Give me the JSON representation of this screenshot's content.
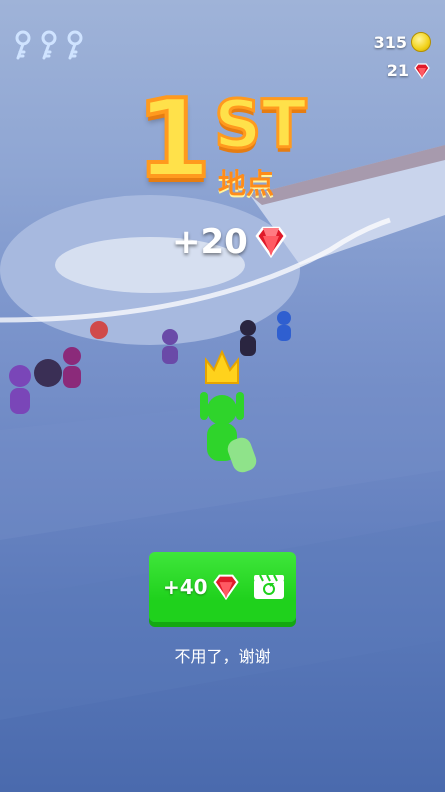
{
  "hud": {
    "keys_count": 3,
    "coins": "315",
    "gems": "21"
  },
  "result": {
    "place_number": "1",
    "place_suffix": "ST",
    "place_label": "地点",
    "reward_text": "+20"
  },
  "cta": {
    "reward_text": "+40"
  },
  "decline_label": "不用了，谢谢",
  "colors": {
    "accent_green": "#1fd11c",
    "title_yellow": "#ffe14a",
    "title_orange": "#ff9a1e",
    "gem_red": "#e01a2a"
  }
}
